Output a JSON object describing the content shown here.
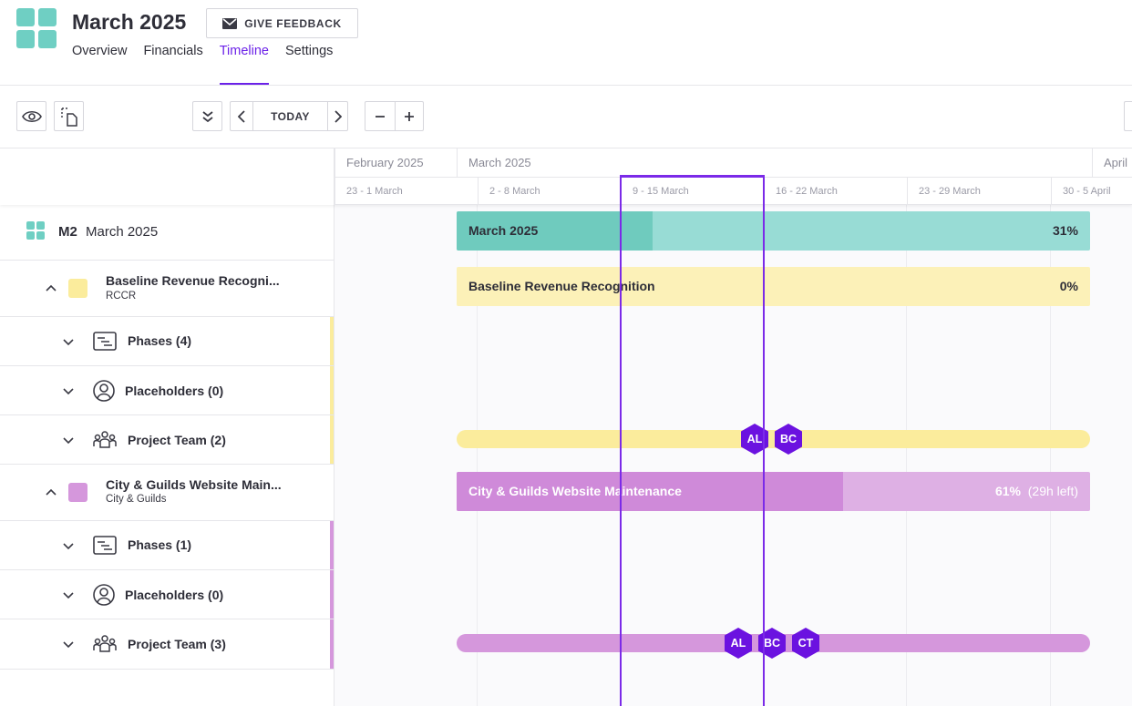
{
  "header": {
    "title": "March 2025",
    "feedback_label": "GIVE FEEDBACK",
    "tabs": [
      {
        "label": "Overview"
      },
      {
        "label": "Financials"
      },
      {
        "label": "Timeline",
        "active": true
      },
      {
        "label": "Settings"
      }
    ]
  },
  "toolbar": {
    "today_label": "TODAY",
    "icons": [
      "eye-icon",
      "copy-icon",
      "collapse-all-icon",
      "chevron-left-icon",
      "chevron-right-icon",
      "minus-icon",
      "plus-icon"
    ]
  },
  "timeline": {
    "months": [
      "February 2025",
      "March 2025",
      "April"
    ],
    "weeks": [
      "23 - 1 March",
      "2 - 8 March",
      "9 - 15 March",
      "16 - 22 March",
      "23 - 29 March",
      "30 - 5 April"
    ],
    "current_week": "9 - 15 March"
  },
  "project": {
    "code": "M2",
    "name": "March 2025",
    "bar_label": "March 2025",
    "progress_label": "31%",
    "progress": 0.31
  },
  "groups": [
    {
      "name": "Baseline Revenue Recogni...",
      "sub": "RCCR",
      "color": "#fbec9c",
      "bar_label": "Baseline Revenue Recognition",
      "progress_label": "0%",
      "rows": [
        {
          "label": "Phases (4)",
          "icon": "phases-icon"
        },
        {
          "label": "Placeholders (0)",
          "icon": "person-icon"
        },
        {
          "label": "Project Team (2)",
          "icon": "team-icon"
        }
      ],
      "team": [
        "AL",
        "BC"
      ]
    },
    {
      "name": "City & Guilds Website Main...",
      "sub": "City & Guilds",
      "color": "#d597dc",
      "bar_label": "City & Guilds Website Maintenance",
      "progress_label": "61%",
      "hours_left_label": "(29h left)",
      "progress": 0.61,
      "rows": [
        {
          "label": "Phases (1)",
          "icon": "phases-icon"
        },
        {
          "label": "Placeholders (0)",
          "icon": "person-icon"
        },
        {
          "label": "Project Team (3)",
          "icon": "team-icon"
        }
      ],
      "team": [
        "AL",
        "BC",
        "CT"
      ]
    }
  ],
  "colors": {
    "accent": "#6b21e8",
    "teal": "#6fcfc3",
    "teal_light": "#98dcd5",
    "yellow": "#fbec9c",
    "yellow_bar": "#fcf1b8",
    "purple": "#cf8ad9",
    "purple_light": "#deb0e4",
    "avatar": "#6b12e0"
  }
}
